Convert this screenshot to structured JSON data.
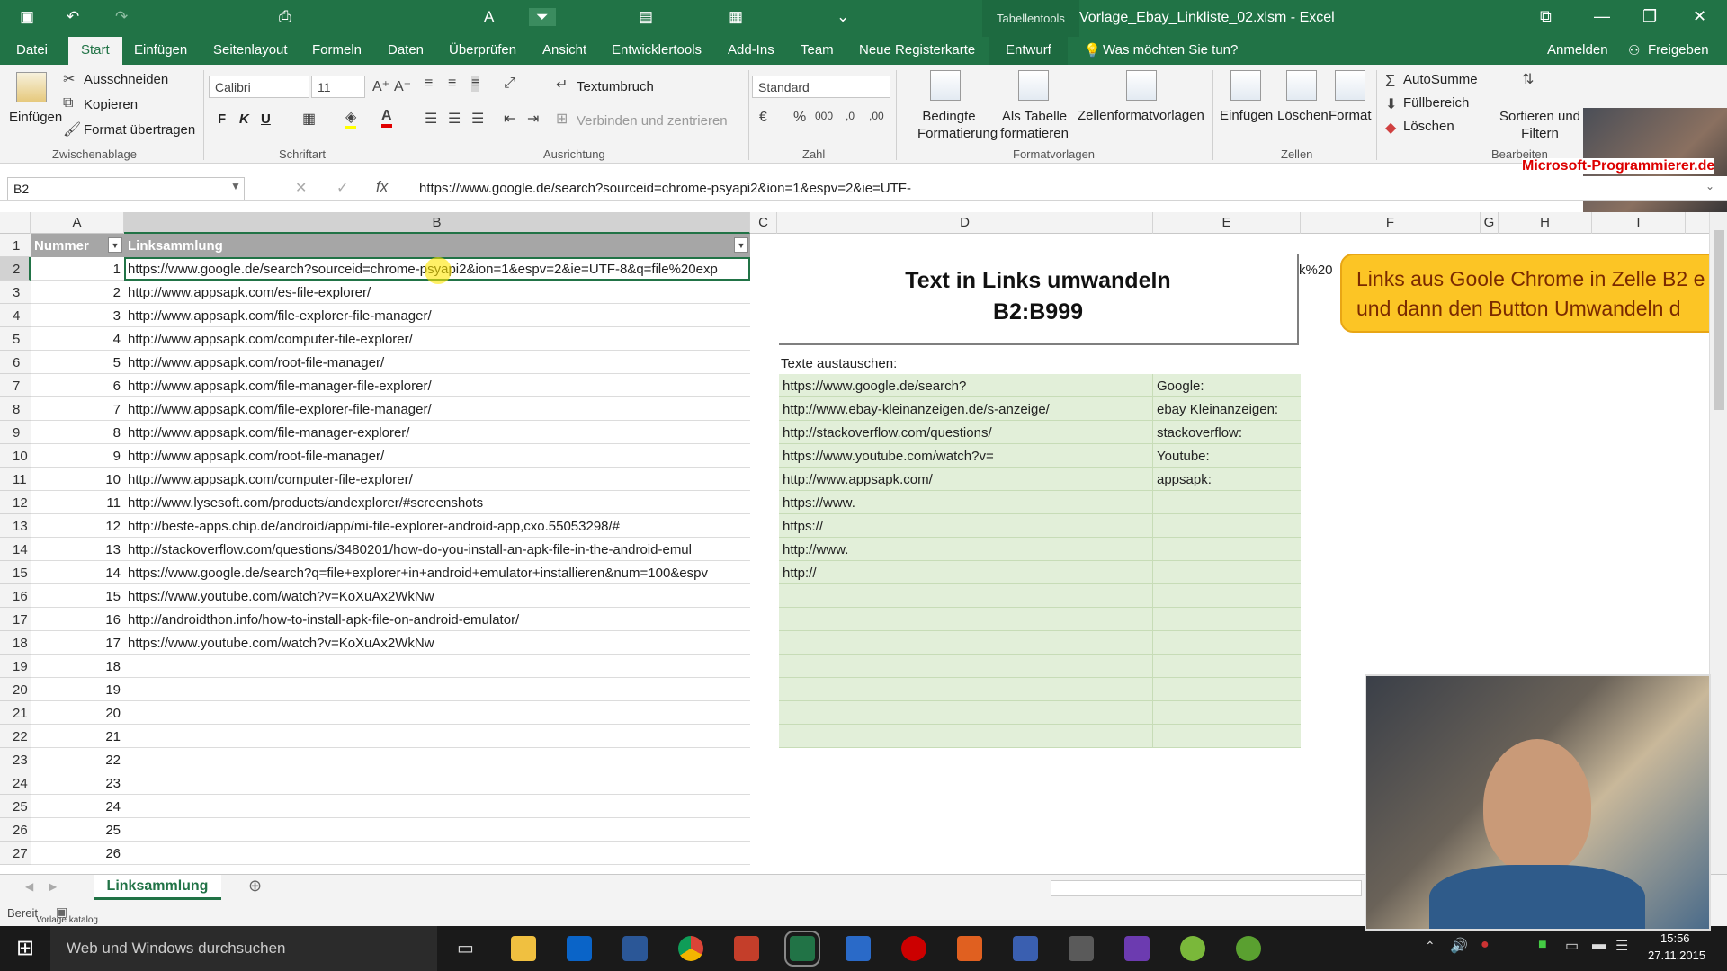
{
  "window": {
    "title": "Vorlage_Ebay_Linkliste_02.xlsm - Excel",
    "table_tools": "Tabellentools"
  },
  "menu": {
    "tabs": [
      "Datei",
      "Start",
      "Einfügen",
      "Seitenlayout",
      "Formeln",
      "Daten",
      "Überprüfen",
      "Ansicht",
      "Entwicklertools",
      "Add-Ins",
      "Team",
      "Neue Registerkarte",
      "Entwurf"
    ],
    "tell_me": "Was möchten Sie tun?",
    "sign_in": "Anmelden",
    "share": "Freigeben"
  },
  "ribbon": {
    "clipboard": {
      "paste": "Einfügen",
      "cut": "Ausschneiden",
      "copy": "Kopieren",
      "format_painter": "Format übertragen",
      "label": "Zwischenablage"
    },
    "font": {
      "name": "Calibri",
      "size": "11",
      "bold": "F",
      "italic": "K",
      "underline": "U",
      "label": "Schriftart"
    },
    "alignment": {
      "wrap": "Textumbruch",
      "merge": "Verbinden und zentrieren",
      "label": "Ausrichtung"
    },
    "number": {
      "format": "Standard",
      "label": "Zahl"
    },
    "styles": {
      "conditional": "Bedingte Formatierung",
      "as_table": "Als Tabelle formatieren",
      "cell_styles": "Zellenformatvorlagen",
      "label": "Formatvorlagen"
    },
    "cells": {
      "insert": "Einfügen",
      "delete": "Löschen",
      "format": "Format",
      "label": "Zellen"
    },
    "editing": {
      "autosum": "AutoSumme",
      "fill": "Füllbereich",
      "clear": "Löschen",
      "sort": "Sortieren und Filtern",
      "label": "Bearbeiten"
    }
  },
  "watermark": "Microsoft-Programmierer.de",
  "formula_bar": {
    "name_box": "B2",
    "content": "https://www.google.de/search?sourceid=chrome-psyapi2&ion=1&espv=2&ie=UTF-"
  },
  "columns": [
    "A",
    "B",
    "C",
    "D",
    "E",
    "F",
    "G",
    "H",
    "I"
  ],
  "table": {
    "headers": [
      "Nummer",
      "Linksammlung"
    ],
    "rows": [
      [
        "1",
        "https://www.google.de/search?sourceid=chrome-psyapi2&ion=1&espv=2&ie=UTF-8&q=file%20exp"
      ],
      [
        "2",
        "http://www.appsapk.com/es-file-explorer/"
      ],
      [
        "3",
        "http://www.appsapk.com/file-explorer-file-manager/"
      ],
      [
        "4",
        "http://www.appsapk.com/computer-file-explorer/"
      ],
      [
        "5",
        "http://www.appsapk.com/root-file-manager/"
      ],
      [
        "6",
        "http://www.appsapk.com/file-manager-file-explorer/"
      ],
      [
        "7",
        "http://www.appsapk.com/file-explorer-file-manager/"
      ],
      [
        "8",
        "http://www.appsapk.com/file-manager-explorer/"
      ],
      [
        "9",
        "http://www.appsapk.com/root-file-manager/"
      ],
      [
        "10",
        "http://www.appsapk.com/computer-file-explorer/"
      ],
      [
        "11",
        "http://www.lysesoft.com/products/andexplorer/#screenshots"
      ],
      [
        "12",
        "http://beste-apps.chip.de/android/app/mi-file-explorer-android-app,cxo.55053298/#"
      ],
      [
        "13",
        "http://stackoverflow.com/questions/3480201/how-do-you-install-an-apk-file-in-the-android-emul"
      ],
      [
        "14",
        "https://www.google.de/search?q=file+explorer+in+android+emulator+installieren&num=100&espv"
      ],
      [
        "15",
        "https://www.youtube.com/watch?v=KoXuAx2WkNw"
      ],
      [
        "16",
        "http://androidthon.info/how-to-install-apk-file-on-android-emulator/"
      ],
      [
        "17",
        "https://www.youtube.com/watch?v=KoXuAx2WkNw"
      ],
      [
        "18",
        ""
      ],
      [
        "19",
        ""
      ],
      [
        "20",
        ""
      ],
      [
        "21",
        ""
      ],
      [
        "22",
        ""
      ],
      [
        "23",
        ""
      ],
      [
        "24",
        ""
      ],
      [
        "25",
        ""
      ],
      [
        "26",
        ""
      ]
    ]
  },
  "panel": {
    "title_line1": "Text in Links umwandeln",
    "title_line2": "B2:B999",
    "overflow_text": "k%20",
    "replace_label": "Texte austauschen:",
    "replacements": [
      [
        "https://www.google.de/search?",
        "Google:"
      ],
      [
        "http://www.ebay-kleinanzeigen.de/s-anzeige/",
        "ebay Kleinanzeigen:"
      ],
      [
        "http://stackoverflow.com/questions/",
        "stackoverflow:"
      ],
      [
        "https://www.youtube.com/watch?v=",
        "Youtube:"
      ],
      [
        "http://www.appsapk.com/",
        "appsapk:"
      ],
      [
        "https://www.",
        ""
      ],
      [
        "https://",
        ""
      ],
      [
        "http://www.",
        ""
      ],
      [
        "http://",
        ""
      ],
      [
        "",
        ""
      ],
      [
        "",
        ""
      ],
      [
        "",
        ""
      ],
      [
        "",
        ""
      ],
      [
        "",
        ""
      ],
      [
        "",
        ""
      ],
      [
        "",
        ""
      ]
    ]
  },
  "callout": {
    "line1": "Links aus Goole Chrome in Zelle B2 e",
    "line2": "und dann den Button Umwandeln d"
  },
  "sheet_tabs": [
    "Linksammlung"
  ],
  "status": {
    "ready": "Bereit",
    "overlay": "Vorlage katalog"
  },
  "taskbar": {
    "search": "Web und Windows durchsuchen",
    "time": "15:56",
    "date": "27.11.2015"
  }
}
